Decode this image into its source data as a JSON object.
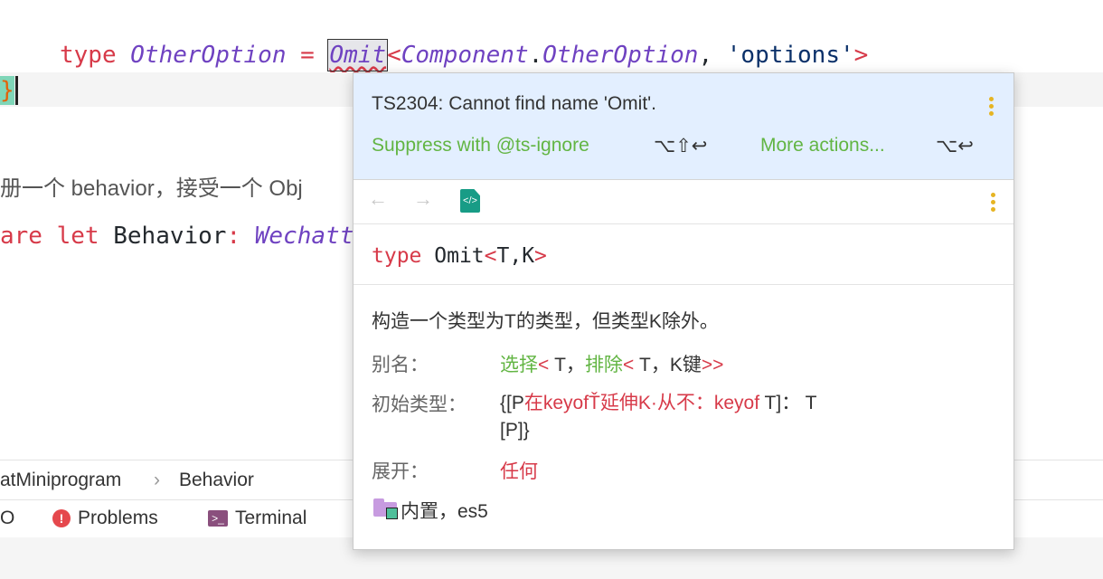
{
  "editor": {
    "code": {
      "kw_type": "type",
      "alias_name": "OtherOption",
      "eq": "=",
      "omit": "Omit",
      "lt": "<",
      "component": "Component",
      "dot": ".",
      "other_option": "OtherOption",
      "comma": ",",
      "str_options": "'options'",
      "gt": ">"
    },
    "brace": "}",
    "comment": "册一个 behavior，接受一个 Obj",
    "declare": {
      "kw": "are let",
      "name": "Behavior",
      "colon": ":",
      "type": "Wechatt"
    }
  },
  "breadcrumb": {
    "items": [
      "atMiniprogram",
      "Behavior"
    ],
    "separator": "›"
  },
  "toolwindows": {
    "partial": "O",
    "problems": "Problems",
    "terminal": "Terminal"
  },
  "popup": {
    "error": "TS2304: Cannot find name 'Omit'.",
    "suppress_label": "Suppress with @ts-ignore",
    "suppress_shortcut": "⌥⇧↩",
    "more_label": "More actions...",
    "more_shortcut": "⌥↩",
    "nav": {
      "back": "←",
      "forward": "→"
    },
    "signature": {
      "kw": "type",
      "name": "Omit",
      "lt": "<",
      "params": "T,K",
      "gt": ">"
    },
    "description": "构造一个类型为T的类型，但类型K除外。",
    "alias_label": "别名：",
    "alias_value": {
      "p1": "选择",
      "p2": "<",
      "p3": " T，",
      "p4": "排除",
      "p5": "<",
      "p6": " T，K键",
      "p7": ">>"
    },
    "initial_label": "初始类型：",
    "initial_value": {
      "p1": "{[P",
      "p2": "在keyofŤ延伸K·从不：keyof",
      "p3": " T]：",
      "p4": " T",
      "p5": "[P]}"
    },
    "expand_label": "展开：",
    "expand_value": "任何",
    "builtin": "内置，es5"
  }
}
